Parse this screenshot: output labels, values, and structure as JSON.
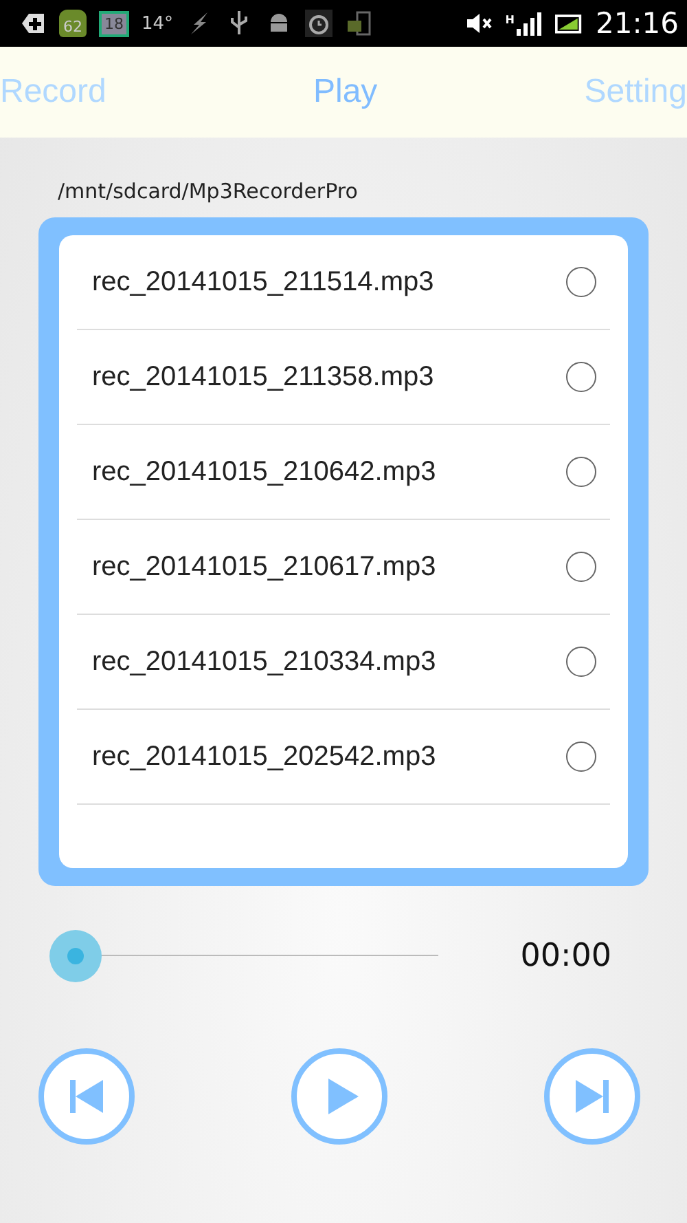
{
  "status_bar": {
    "notifications": [
      {
        "kind": "badge",
        "text": "62"
      },
      {
        "kind": "calendar",
        "text": "18"
      },
      {
        "kind": "text",
        "text": "14°"
      }
    ],
    "network": "H",
    "time": "21:16"
  },
  "tabs": [
    {
      "label": "Record",
      "selected": false
    },
    {
      "label": "Play",
      "selected": true
    },
    {
      "label": "Setting",
      "selected": false
    }
  ],
  "folder_path": "/mnt/sdcard/Mp3RecorderPro",
  "files": [
    {
      "name": "rec_20141015_211514.mp3",
      "selected": false
    },
    {
      "name": "rec_20141015_211358.mp3",
      "selected": false
    },
    {
      "name": "rec_20141015_210642.mp3",
      "selected": false
    },
    {
      "name": "rec_20141015_210617.mp3",
      "selected": false
    },
    {
      "name": "rec_20141015_210334.mp3",
      "selected": false
    },
    {
      "name": "rec_20141015_202542.mp3",
      "selected": false
    }
  ],
  "player": {
    "time": "00:00"
  }
}
